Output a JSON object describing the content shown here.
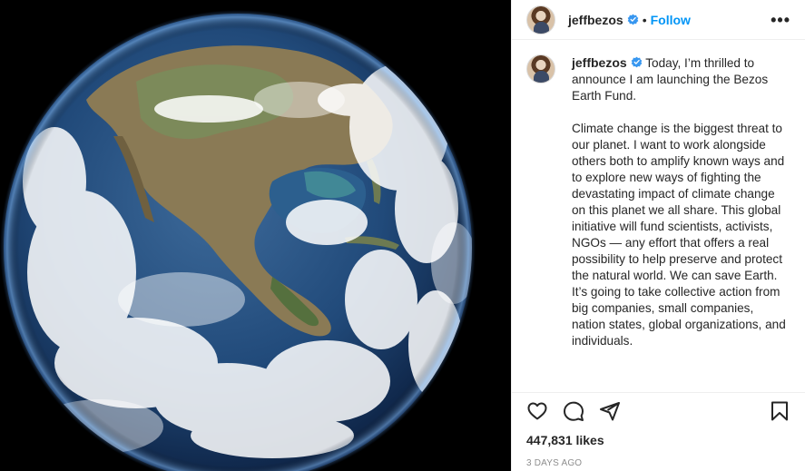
{
  "media": {
    "description_icon": "earth-photo"
  },
  "header": {
    "username": "jeffbezos",
    "separator": "•",
    "follow_label": "Follow",
    "more_label": "•••"
  },
  "caption": {
    "username": "jeffbezos",
    "paragraphs": [
      "Today, I’m thrilled to announce I am launching the Bezos Earth Fund.",
      "Climate change is the biggest threat to our planet. I want to work alongside others both to amplify known ways and to explore new ways of fighting the devastating impact of climate change on this planet we all share. This global initiative will fund scientists, activists, NGOs — any effort that offers a real possibility to help preserve and protect the natural world. We can save Earth. It’s going to take collective action from big companies, small companies, nation states, global organizations, and individuals."
    ]
  },
  "actions": {
    "like_icon": "heart-icon",
    "comment_icon": "comment-icon",
    "share_icon": "send-icon",
    "save_icon": "bookmark-icon"
  },
  "likes_text": "447,831 likes",
  "timestamp": "3 DAYS AGO",
  "colors": {
    "link_blue": "#0095f6",
    "verified_blue": "#3897f0",
    "text": "#262626",
    "muted": "#8e8e8e"
  }
}
